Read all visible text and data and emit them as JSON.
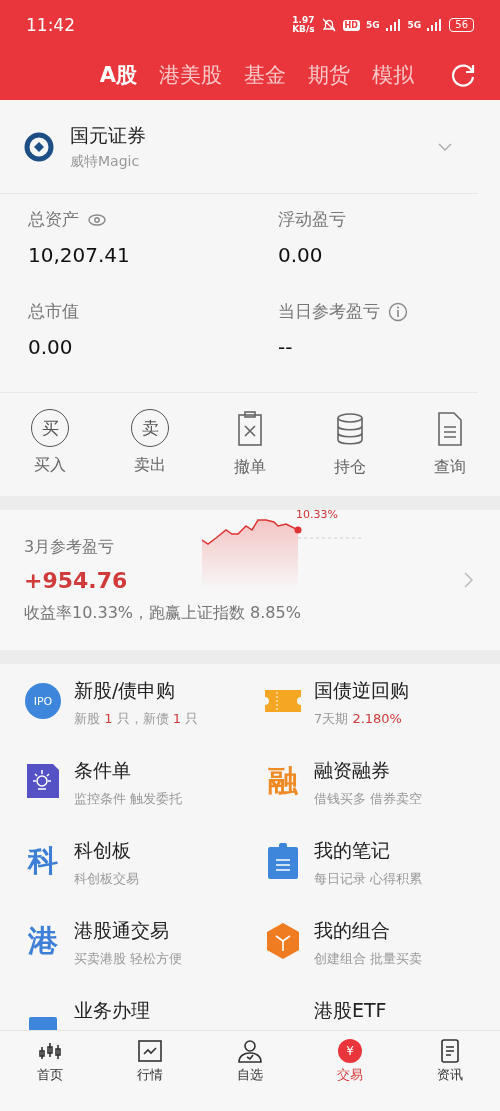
{
  "status_bar": {
    "time": "11:42",
    "speed_value": "1.97",
    "speed_unit": "KB/s",
    "hd_label": "HD",
    "signals": [
      "5G",
      "5G"
    ],
    "battery": "56"
  },
  "tabs": [
    {
      "label": "A股",
      "selected": true
    },
    {
      "label": "港美股",
      "selected": false
    },
    {
      "label": "基金",
      "selected": false
    },
    {
      "label": "期货",
      "selected": false
    },
    {
      "label": "模拟",
      "selected": false
    }
  ],
  "account": {
    "name": "国元证券",
    "subtitle": "威特Magic"
  },
  "stats": [
    {
      "label": "总资产",
      "value": "10,207.41",
      "kind": "eye"
    },
    {
      "label": "浮动盈亏",
      "value": "0.00",
      "kind": "plain"
    },
    {
      "label": "总市值",
      "value": "0.00",
      "kind": "plain"
    },
    {
      "label": "当日参考盈亏",
      "value": "--",
      "kind": "info"
    }
  ],
  "actions": [
    {
      "label": "买入",
      "kind": "glyph",
      "glyph": "买"
    },
    {
      "label": "卖出",
      "kind": "glyph",
      "glyph": "卖"
    },
    {
      "label": "撤单",
      "kind": "cancel"
    },
    {
      "label": "持仓",
      "kind": "database"
    },
    {
      "label": "查询",
      "kind": "document"
    }
  ],
  "monthly": {
    "title": "3月参考盈亏",
    "value": "+954.76",
    "summary": "收益率10.33%，跑赢上证指数 8.85%",
    "chart_label": "10.33%"
  },
  "features": [
    {
      "title": "新股/债申购",
      "kind": "ipo",
      "icon_text": "IPO",
      "subtitle": [
        {
          "text": "新股 ",
          "highlight": false
        },
        {
          "text": "1",
          "highlight": true
        },
        {
          "text": " 只，新债 ",
          "highlight": false
        },
        {
          "text": "1",
          "highlight": true
        },
        {
          "text": " 只",
          "highlight": false
        }
      ]
    },
    {
      "title": "国债逆回购",
      "kind": "ticket",
      "subtitle": [
        {
          "text": "7天期 ",
          "highlight": false
        },
        {
          "text": "2.180%",
          "highlight": true
        }
      ]
    },
    {
      "title": "条件单",
      "kind": "bulb",
      "subtitle": [
        {
          "text": "监控条件 触发委托",
          "highlight": false
        }
      ]
    },
    {
      "title": "融资融券",
      "kind": "glyph",
      "icon_text": "融",
      "color": "#f08a24",
      "subtitle": [
        {
          "text": "借钱买多 借券卖空",
          "highlight": false
        }
      ]
    },
    {
      "title": "科创板",
      "kind": "glyph",
      "icon_text": "科",
      "color": "#3d7fd6",
      "subtitle": [
        {
          "text": "科创板交易",
          "highlight": false
        }
      ]
    },
    {
      "title": "我的笔记",
      "kind": "note",
      "subtitle": [
        {
          "text": "每日记录 心得积累",
          "highlight": false
        }
      ]
    },
    {
      "title": "港股通交易",
      "kind": "glyph",
      "icon_text": "港",
      "color": "#3d7fd6",
      "subtitle": [
        {
          "text": "买卖港股 轻松方便",
          "highlight": false
        }
      ]
    },
    {
      "title": "我的组合",
      "kind": "cube",
      "subtitle": [
        {
          "text": "创建组合 批量买卖",
          "highlight": false
        }
      ]
    },
    {
      "title": "业务办理",
      "kind": "bar"
    },
    {
      "title": "港股ETF",
      "kind": "plain"
    }
  ],
  "nav": [
    {
      "label": "首页",
      "kind": "candles",
      "selected": false
    },
    {
      "label": "行情",
      "kind": "chart",
      "selected": false
    },
    {
      "label": "自选",
      "kind": "person",
      "selected": false
    },
    {
      "label": "交易",
      "kind": "yen",
      "glyph": "¥",
      "selected": true
    },
    {
      "label": "资讯",
      "kind": "doc",
      "selected": false
    }
  ]
}
